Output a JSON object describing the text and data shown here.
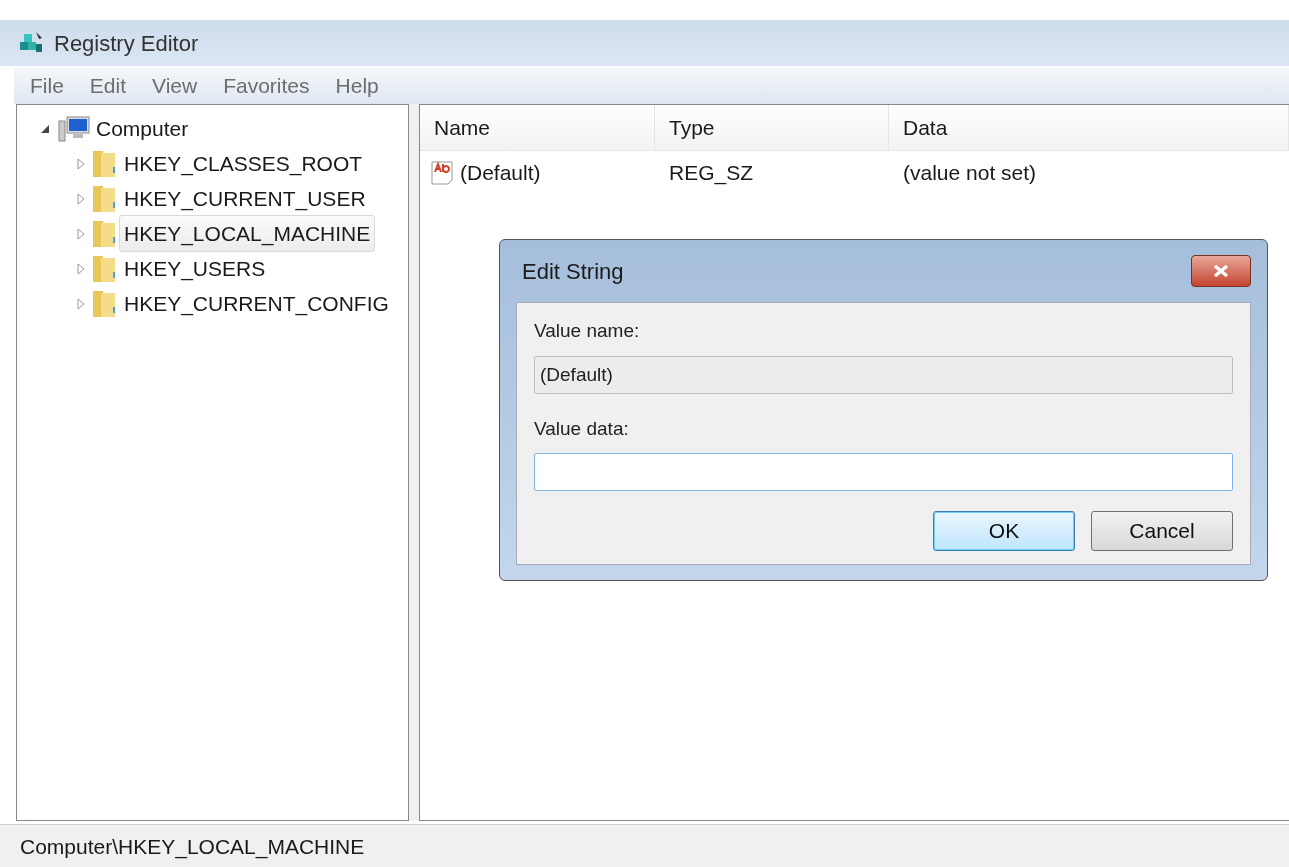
{
  "window": {
    "title": "Registry Editor"
  },
  "menu": [
    "File",
    "Edit",
    "View",
    "Favorites",
    "Help"
  ],
  "tree": {
    "label": "Computer",
    "expanded": true,
    "selected": false,
    "children": [
      {
        "label": "HKEY_CLASSES_ROOT",
        "expanded": false,
        "selected": false
      },
      {
        "label": "HKEY_CURRENT_USER",
        "expanded": false,
        "selected": false
      },
      {
        "label": "HKEY_LOCAL_MACHINE",
        "expanded": false,
        "selected": true
      },
      {
        "label": "HKEY_USERS",
        "expanded": false,
        "selected": false
      },
      {
        "label": "HKEY_CURRENT_CONFIG",
        "expanded": false,
        "selected": false
      }
    ]
  },
  "table": {
    "columns": [
      "Name",
      "Type",
      "Data"
    ],
    "rows": [
      {
        "name": "(Default)",
        "type": "REG_SZ",
        "data": "(value not set)"
      }
    ]
  },
  "dialog": {
    "title": "Edit String",
    "value_name_label": "Value name:",
    "value_name": "(Default)",
    "value_data_label": "Value data:",
    "buttons": [
      {
        "label": "OK",
        "default": true
      },
      {
        "label": "Cancel",
        "default": false
      }
    ]
  },
  "status_bar": "Computer\\HKEY_LOCAL_MACHINE"
}
